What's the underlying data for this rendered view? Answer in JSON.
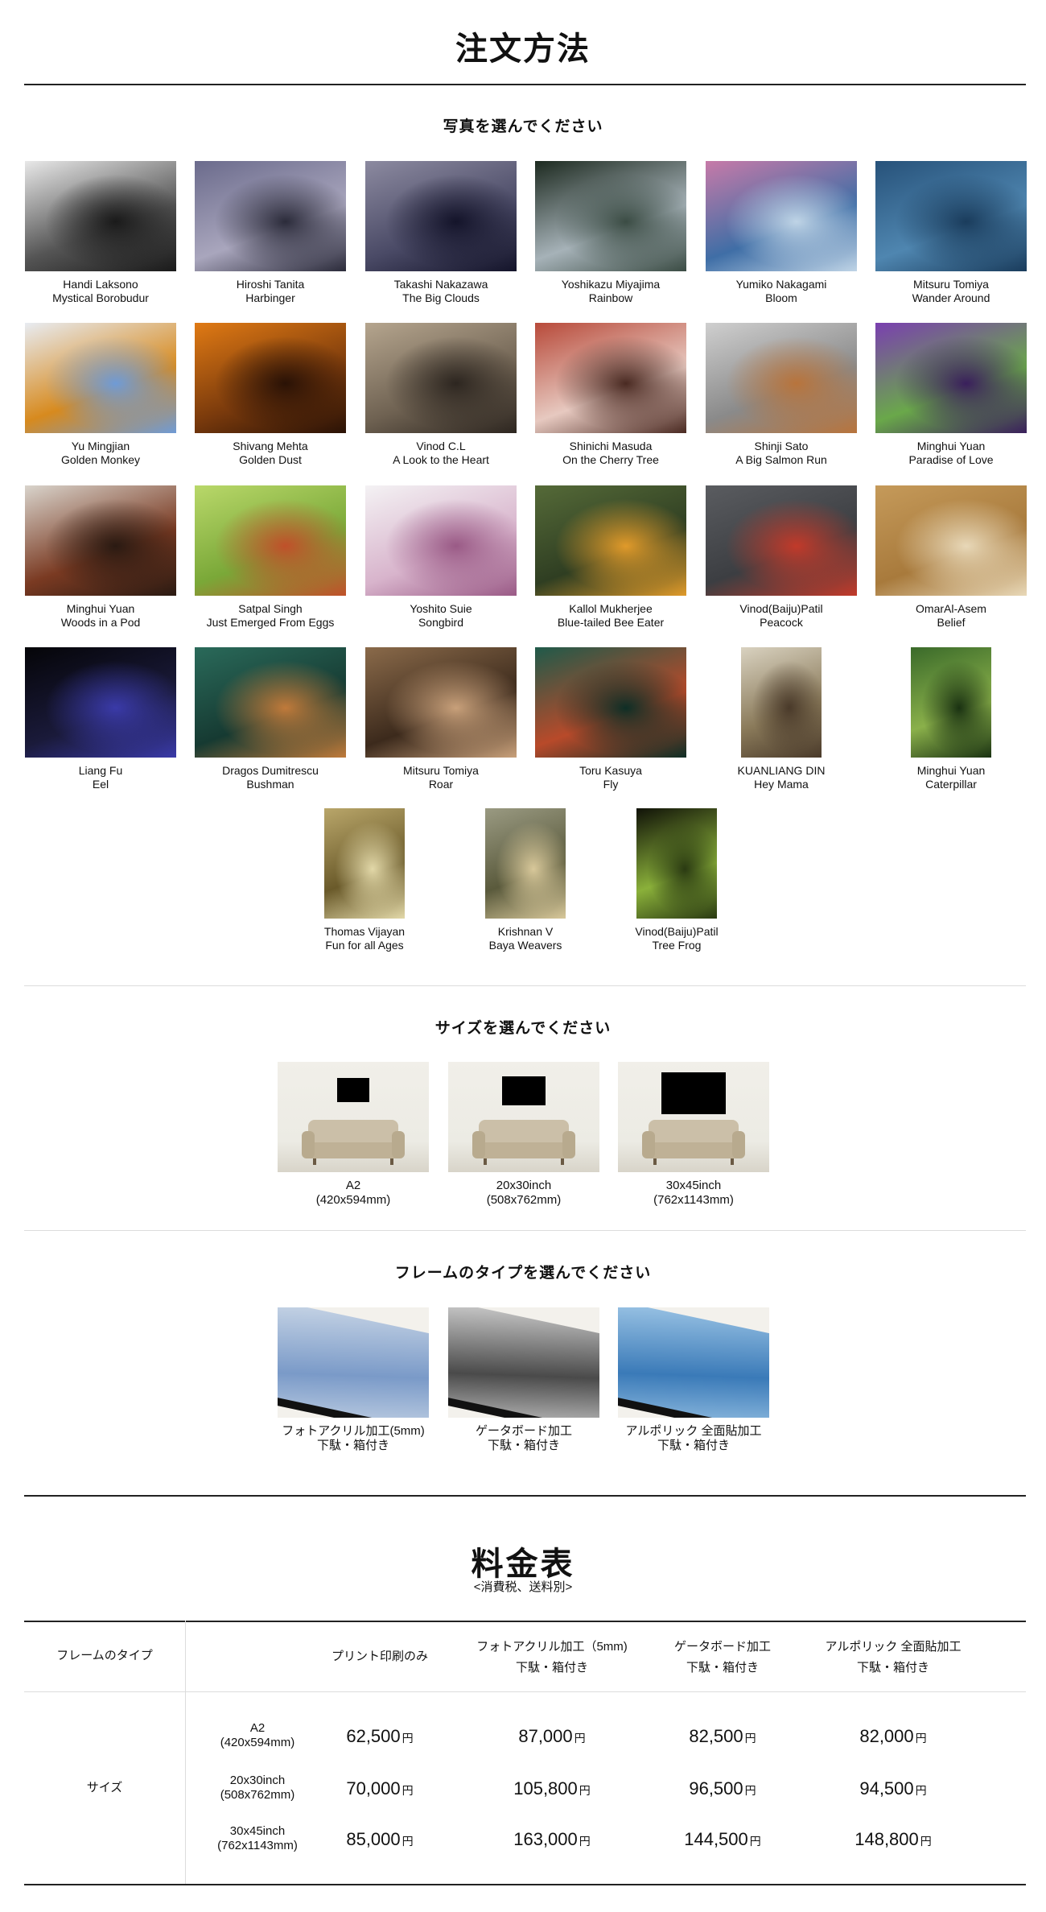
{
  "header": {
    "title": "注文方法"
  },
  "photos": {
    "section_title": "写真を選んでください",
    "items": [
      {
        "photographer": "Handi Laksono",
        "title": "Mystical Borobudur",
        "colors": [
          "#e8e8e8",
          "#555555",
          "#1a1a1a"
        ],
        "orientation": "landscape"
      },
      {
        "photographer": "Hiroshi Tanita",
        "title": "Harbinger",
        "colors": [
          "#6b6b8c",
          "#a9a6bd",
          "#2b2b3a"
        ],
        "orientation": "landscape"
      },
      {
        "photographer": "Takashi Nakazawa",
        "title": "The Big Clouds",
        "colors": [
          "#8c8aa0",
          "#4a4a66",
          "#14142a"
        ],
        "orientation": "landscape"
      },
      {
        "photographer": "Yoshikazu Miyajima",
        "title": "Rainbow",
        "colors": [
          "#1d2a20",
          "#a6b2b8",
          "#3b4c44"
        ],
        "orientation": "landscape"
      },
      {
        "photographer": "Yumiko Nakagami",
        "title": "Bloom",
        "colors": [
          "#c77aa8",
          "#3f6ea6",
          "#bfd4e6"
        ],
        "orientation": "landscape"
      },
      {
        "photographer": "Mitsuru Tomiya",
        "title": "Wander Around",
        "colors": [
          "#27527a",
          "#4f86b0",
          "#1a3c5c"
        ],
        "orientation": "landscape"
      },
      {
        "photographer": "Yu Mingjian",
        "title": "Golden Monkey",
        "colors": [
          "#e8ecf2",
          "#d78a1e",
          "#6f9bd6"
        ],
        "orientation": "landscape"
      },
      {
        "photographer": "Shivang Mehta",
        "title": "Golden Dust",
        "colors": [
          "#e07a14",
          "#7a3a0c",
          "#2a1206"
        ],
        "orientation": "landscape"
      },
      {
        "photographer": "Vinod C.L",
        "title": "A Look to the Heart",
        "colors": [
          "#b5a58e",
          "#6f6252",
          "#2d2620"
        ],
        "orientation": "landscape"
      },
      {
        "photographer": "Shinichi Masuda",
        "title": "On the Cherry Tree",
        "colors": [
          "#b84a3a",
          "#e7c9c0",
          "#4a2a22"
        ],
        "orientation": "landscape"
      },
      {
        "photographer": "Shinji Sato",
        "title": "A Big Salmon Run",
        "colors": [
          "#cfcfcf",
          "#8a8a8a",
          "#b8743c"
        ],
        "orientation": "landscape"
      },
      {
        "photographer": "Minghui Yuan",
        "title": "Paradise of Love",
        "colors": [
          "#7a3fb0",
          "#6aa84a",
          "#3a1f5c"
        ],
        "orientation": "landscape"
      },
      {
        "photographer": "Minghui Yuan",
        "title": "Woods in a Pod",
        "colors": [
          "#d9d4cc",
          "#7a3a22",
          "#2a1a12"
        ],
        "orientation": "landscape"
      },
      {
        "photographer": "Satpal Singh",
        "title": "Just Emerged From Eggs",
        "colors": [
          "#b9d86a",
          "#7aa838",
          "#c0502a"
        ],
        "orientation": "landscape"
      },
      {
        "photographer": "Yoshito Suie",
        "title": "Songbird",
        "colors": [
          "#f4f2f4",
          "#d8b4cc",
          "#9a5a86"
        ],
        "orientation": "landscape"
      },
      {
        "photographer": "Kallol Mukherjee",
        "title": "Blue-tailed Bee Eater",
        "colors": [
          "#556a38",
          "#2f3e22",
          "#e09a2a"
        ],
        "orientation": "landscape"
      },
      {
        "photographer": "Vinod(Baiju)Patil",
        "title": "Peacock",
        "colors": [
          "#5a5c60",
          "#3c3e42",
          "#c23a2a"
        ],
        "orientation": "landscape"
      },
      {
        "photographer": "OmarAl-Asem",
        "title": "Belief",
        "colors": [
          "#c59a5a",
          "#a87a3c",
          "#e8d8b8"
        ],
        "orientation": "landscape"
      },
      {
        "photographer": "Liang Fu",
        "title": "Eel",
        "colors": [
          "#050508",
          "#1a1a3a",
          "#3a3aa8"
        ],
        "orientation": "landscape"
      },
      {
        "photographer": "Dragos Dumitrescu",
        "title": "Bushman",
        "colors": [
          "#2a6a5a",
          "#163a32",
          "#c07a3a"
        ],
        "orientation": "landscape"
      },
      {
        "photographer": "Mitsuru Tomiya",
        "title": "Roar",
        "colors": [
          "#8a6a4a",
          "#3c2a1c",
          "#c8a07a"
        ],
        "orientation": "landscape"
      },
      {
        "photographer": "Toru Kasuya",
        "title": "Fly",
        "colors": [
          "#1f5a4a",
          "#b84a2a",
          "#0e2e26"
        ],
        "orientation": "landscape"
      },
      {
        "photographer": "KUANLIANG DIN",
        "title": "Hey Mama",
        "colors": [
          "#d9d2c0",
          "#8a7a5a",
          "#4a3a2a"
        ],
        "orientation": "portrait"
      },
      {
        "photographer": "Minghui Yuan",
        "title": "Caterpillar",
        "colors": [
          "#3a6a2a",
          "#8ab04a",
          "#1a3212"
        ],
        "orientation": "portrait"
      },
      {
        "photographer": "Thomas Vijayan",
        "title": "Fun for all Ages",
        "colors": [
          "#b9a66a",
          "#6a5a2a",
          "#e2d8a8"
        ],
        "orientation": "portrait"
      },
      {
        "photographer": "Krishnan V",
        "title": "Baya Weavers",
        "colors": [
          "#9a9a82",
          "#5a5a3c",
          "#d8c89a"
        ],
        "orientation": "portrait"
      },
      {
        "photographer": "Vinod(Baiju)Patil",
        "title": "Tree Frog",
        "colors": [
          "#101208",
          "#8ab03a",
          "#2a3a12"
        ],
        "orientation": "portrait"
      }
    ]
  },
  "sizes": {
    "section_title": "サイズを選んでください",
    "items": [
      {
        "name": "A2",
        "dims": "(420x594mm)"
      },
      {
        "name": "20x30inch",
        "dims": "(508x762mm)"
      },
      {
        "name": "30x45inch",
        "dims": "(762x1143mm)"
      }
    ]
  },
  "frames": {
    "section_title": "フレームのタイプを選んでください",
    "items": [
      {
        "name": "フォトアクリル加工(5mm)",
        "note": "下駄・箱付き",
        "colors": [
          "#7a9ac8",
          "#c9d6e6"
        ]
      },
      {
        "name": "ゲータボード加工",
        "note": "下駄・箱付き",
        "colors": [
          "#4a4a4a",
          "#cfcfcf"
        ]
      },
      {
        "name": "アルポリック 全面貼加工",
        "note": "下駄・箱付き",
        "colors": [
          "#3a7ab8",
          "#9ec6e6"
        ]
      }
    ]
  },
  "pricing": {
    "title": "料金表",
    "subtitle": "<消費税、送料別>",
    "frame_type_label": "フレームのタイプ",
    "size_label": "サイズ",
    "columns": [
      {
        "line1": "プリント印刷のみ",
        "line2": ""
      },
      {
        "line1": "フォトアクリル加工（5mm)",
        "line2": "下駄・箱付き"
      },
      {
        "line1": "ゲータボード加工",
        "line2": "下駄・箱付き"
      },
      {
        "line1": "アルポリック 全面貼加工",
        "line2": "下駄・箱付き"
      }
    ],
    "rows": [
      {
        "size": "A2",
        "dims": "(420x594mm)",
        "prices": [
          "62,500",
          "87,000",
          "82,500",
          "82,000"
        ]
      },
      {
        "size": "20x30inch",
        "dims": "(508x762mm)",
        "prices": [
          "70,000",
          "105,800",
          "96,500",
          "94,500"
        ]
      },
      {
        "size": "30x45inch",
        "dims": "(762x1143mm)",
        "prices": [
          "85,000",
          "163,000",
          "144,500",
          "148,800"
        ]
      }
    ],
    "currency": "円"
  }
}
